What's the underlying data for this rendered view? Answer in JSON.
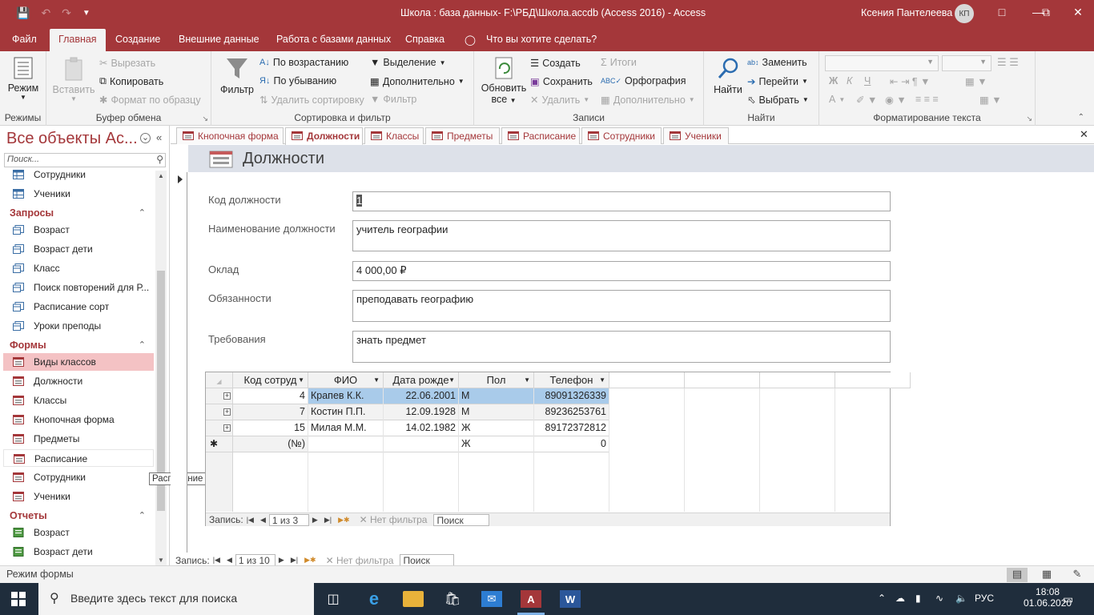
{
  "titlebar": {
    "title": "Школа : база данных- F:\\РБД\\Школа.accdb (Access 2016)  -  Access",
    "user": "Ксения Пантелеева",
    "avatar": "КП"
  },
  "ribbon_tabs": [
    "Файл",
    "Главная",
    "Создание",
    "Внешние данные",
    "Работа с базами данных",
    "Справка"
  ],
  "tell_me": "Что вы хотите сделать?",
  "ribbon": {
    "views": {
      "label": "Режимы",
      "view_button": "Режим"
    },
    "clipboard": {
      "label": "Буфер обмена",
      "paste": "Вставить",
      "cut": "Вырезать",
      "copy": "Копировать",
      "format_painter": "Формат по образцу"
    },
    "sort_filter": {
      "label": "Сортировка и фильтр",
      "filter": "Фильтр",
      "ascending": "По возрастанию",
      "descending": "По убыванию",
      "remove_sort": "Удалить сортировку",
      "selection": "Выделение",
      "advanced": "Дополнительно",
      "toggle_filter": "Фильтр"
    },
    "records": {
      "label": "Записи",
      "refresh": "Обновить",
      "refresh2": "все",
      "new": "Создать",
      "save": "Сохранить",
      "delete": "Удалить",
      "totals": "Итоги",
      "spelling": "Орфография",
      "more": "Дополнительно"
    },
    "find": {
      "label": "Найти",
      "find": "Найти",
      "replace": "Заменить",
      "goto": "Перейти",
      "select": "Выбрать"
    },
    "text_format": {
      "label": "Форматирование текста",
      "bold": "Ж",
      "italic": "К",
      "underline": "Ч",
      "font_color": "A"
    }
  },
  "navpane": {
    "title": "Все объекты Ac...",
    "search_placeholder": "Поиск...",
    "items_top": [
      {
        "label": "Сотрудники",
        "type": "table"
      },
      {
        "label": "Ученики",
        "type": "table"
      }
    ],
    "sections": [
      {
        "title": "Запросы",
        "items": [
          "Возраст",
          "Возраст дети",
          "Класс",
          "Поиск повторений для Р...",
          "Расписание сорт",
          "Уроки преподы"
        ]
      },
      {
        "title": "Формы",
        "items": [
          "Виды классов",
          "Должности",
          "Классы",
          "Кнопочная форма",
          "Предметы",
          "Расписание",
          "Сотрудники",
          "Ученики"
        ]
      },
      {
        "title": "Отчеты",
        "items": [
          "Возраст",
          "Возраст дети",
          "Класс"
        ]
      }
    ],
    "tooltip": "Расписание"
  },
  "doc_tabs": [
    "Кнопочная форма",
    "Должности",
    "Классы",
    "Предметы",
    "Расписание",
    "Сотрудники",
    "Ученики"
  ],
  "active_tab": "Должности",
  "form": {
    "title": "Должности",
    "fields": [
      {
        "label": "Код должности",
        "value": "1"
      },
      {
        "label": "Наименование должности",
        "value": "учитель географии"
      },
      {
        "label": "Оклад",
        "value": "4 000,00 ₽"
      },
      {
        "label": "Обязанности",
        "value": "преподавать географию"
      },
      {
        "label": "Требования",
        "value": "знать предмет"
      }
    ]
  },
  "subform": {
    "columns": [
      "Код сотруд",
      "ФИО",
      "Дата рожде",
      "Пол",
      "Телефон"
    ],
    "rows": [
      [
        "4",
        "Крапев К.К.",
        "22.06.2001",
        "М",
        "89091326339"
      ],
      [
        "7",
        "Костин П.П.",
        "12.09.1928",
        "М",
        "89236253761"
      ],
      [
        "15",
        "Милая М.М.",
        "14.02.1982",
        "Ж",
        "89172372812"
      ]
    ],
    "new_row": [
      "(№)",
      "",
      "",
      "Ж",
      "0"
    ],
    "nav": {
      "label": "Запись:",
      "position": "1 из 3",
      "filter": "Нет фильтра",
      "search": "Поиск"
    }
  },
  "main_nav": {
    "label": "Запись:",
    "position": "1 из 10",
    "filter": "Нет фильтра",
    "search": "Поиск"
  },
  "status": {
    "mode": "Режим формы"
  },
  "taskbar": {
    "search_placeholder": "Введите здесь текст для поиска",
    "lang": "РУС",
    "time": "18:08",
    "date": "01.06.2020"
  }
}
